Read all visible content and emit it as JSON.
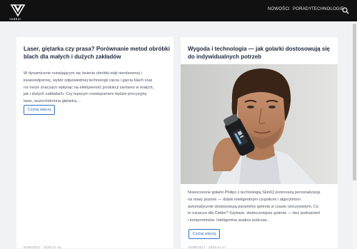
{
  "header": {
    "logo_text": "YABBIO",
    "nav": [
      "NOWOŚCI",
      "PORADY",
      "TECHNOLOGIE"
    ]
  },
  "posts": [
    {
      "title": "Laser, giętarka czy prasa? Porównanie metod obróbki blach dla małych i dużych zakładów",
      "excerpt": [
        "W dynamicznie rozwijającym się świecie obróbki stali nierdzewnej i",
        "kwasoodpornej, wybór odpowiedniej technologii cięcia i gięcia blach oraz",
        "rur może znacząco wpłynąć na efektywność produkcji zarówno w małych,",
        "jak i dużych zakładach. Czy lepszym rozwiązaniem będzie precyzyjny",
        "laser, wszechstronna giętarka,..."
      ],
      "button": "Czytaj więcej",
      "meta": "NOWOŚCI · 2025-11-16"
    },
    {
      "title": "Wygoda i technologia — jak golarki dostosowują się do indywidualnych potrzeb",
      "excerpt": [
        "Nowoczesne golarki Philips z technologią SkinIQ przenoszą personalizację",
        "na nowy poziom — dzięki inteligentnym czujnikom i algorytmom",
        "automatycznie dostosowują parametry golenia w czasie rzeczywistym. Co",
        "to oznacza dla Ciebie? Szybsze, skuteczniejsze golenie — bez podrażnień",
        "i kompromisów.  Inteligentna analiza podczas..."
      ],
      "button": "Czytaj więcej",
      "meta": "NOWOŚCI · 2025-11-17"
    }
  ],
  "colors": {
    "accent": "#2f6fc4",
    "topbar": "#111111"
  }
}
